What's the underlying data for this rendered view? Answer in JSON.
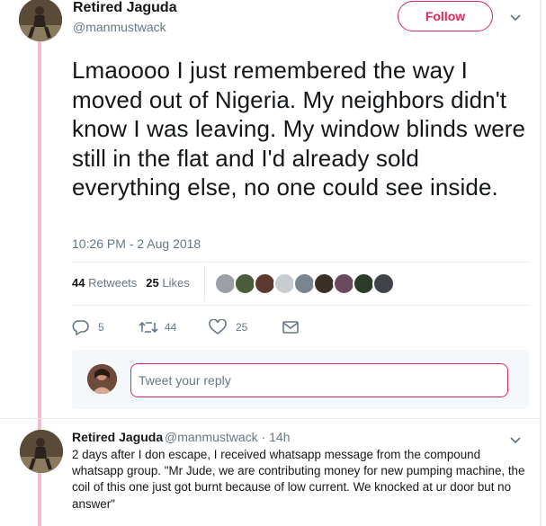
{
  "tweet": {
    "display_name": "Retired Jaguda",
    "handle": "@manmustwack",
    "follow_label": "Follow",
    "text": "Lmaoooo I just remembered the way I moved out of Nigeria. My neighbors didn't know I was leaving. My window blinds were still in the flat and I'd already sold everything else, no one could see inside.",
    "timestamp": "10:26 PM - 2 Aug 2018",
    "retweets_count": "44",
    "retweets_label": "Retweets",
    "likes_count": "25",
    "likes_label": "Likes"
  },
  "actions": {
    "reply_count": "5",
    "retweet_count": "44",
    "like_count": "25"
  },
  "reply_box": {
    "placeholder": "Tweet your reply"
  },
  "reply": {
    "display_name": "Retired Jaguda",
    "handle_time": "@manmustwack · 14h",
    "text": "2 days after I don escape, I received whatsapp message from the compound whatsapp group. \"Mr Jude, we are contributing money for new pumping machine, the coil of this one just got burnt because of low current. We knocked at ur door but no answer\""
  },
  "colors": {
    "accent": "#e0245e",
    "thread_line": "#f2bccd",
    "secondary_text": "#657786"
  },
  "icons": [
    "reply-icon",
    "retweet-icon",
    "heart-icon",
    "message-icon",
    "chevron-down-icon"
  ]
}
